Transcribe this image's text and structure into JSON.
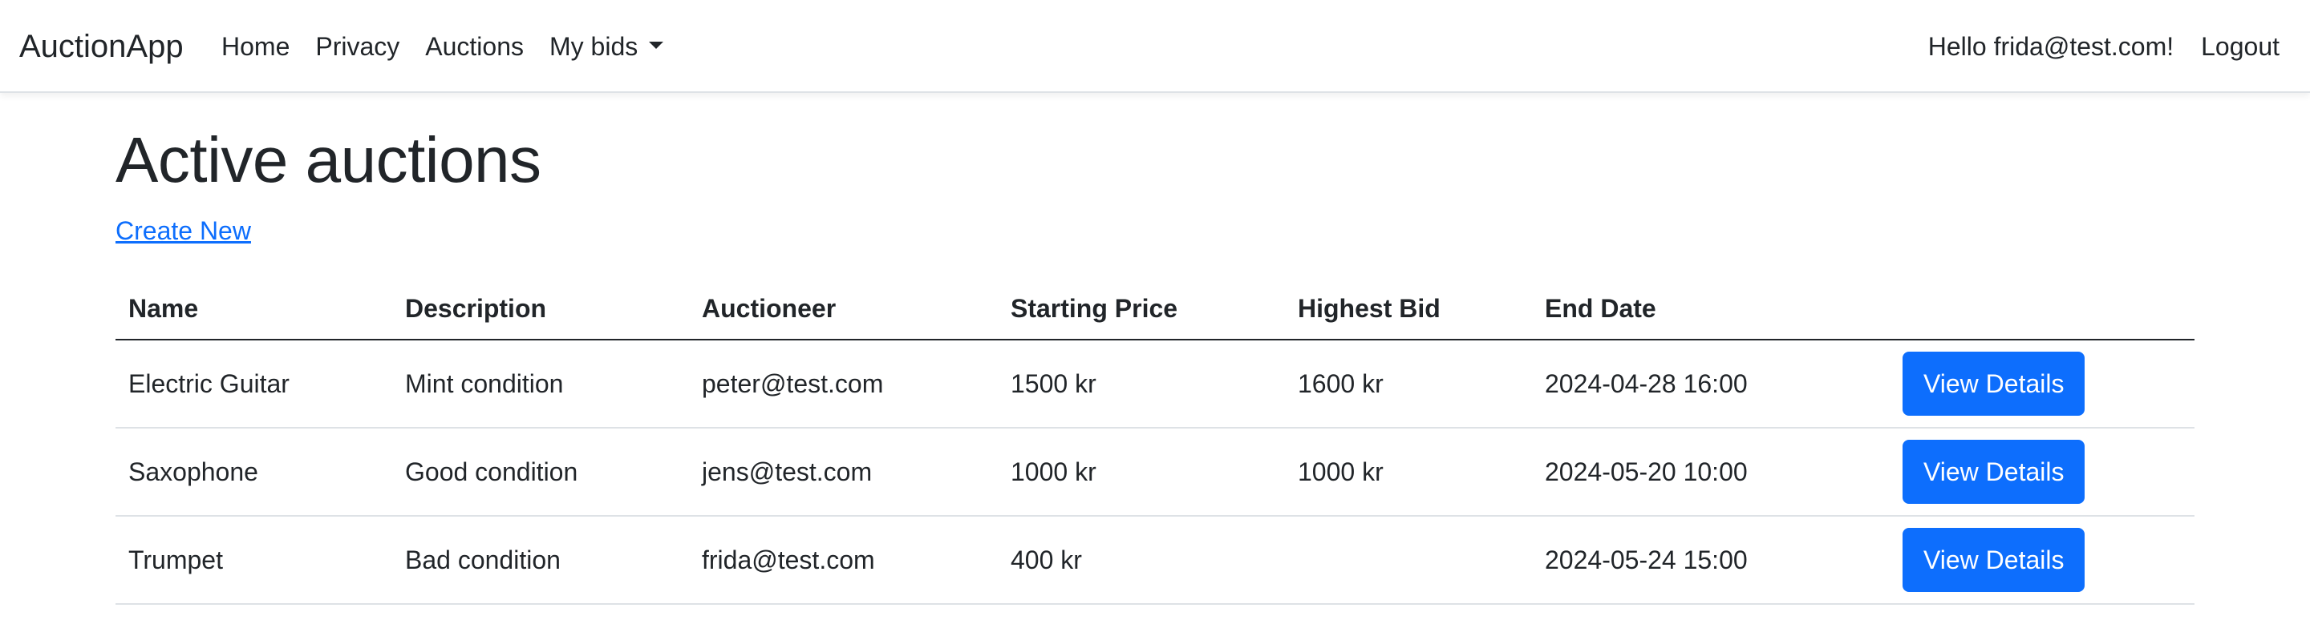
{
  "navbar": {
    "brand": "AuctionApp",
    "links": [
      "Home",
      "Privacy",
      "Auctions"
    ],
    "dropdown_label": "My bids",
    "greeting": "Hello frida@test.com!",
    "logout": "Logout"
  },
  "main": {
    "title": "Active auctions",
    "create_new": "Create New",
    "table": {
      "headers": [
        "Name",
        "Description",
        "Auctioneer",
        "Starting Price",
        "Highest Bid",
        "End Date",
        ""
      ],
      "rows": [
        {
          "name": "Electric Guitar",
          "description": "Mint condition",
          "auctioneer": "peter@test.com",
          "starting_price": "1500 kr",
          "highest_bid": "1600 kr",
          "end_date": "2024-04-28 16:00",
          "action": "View Details"
        },
        {
          "name": "Saxophone",
          "description": "Good condition",
          "auctioneer": "jens@test.com",
          "starting_price": "1000 kr",
          "highest_bid": "1000 kr",
          "end_date": "2024-05-20 10:00",
          "action": "View Details"
        },
        {
          "name": "Trumpet",
          "description": "Bad condition",
          "auctioneer": "frida@test.com",
          "starting_price": "400 kr",
          "highest_bid": "",
          "end_date": "2024-05-24 15:00",
          "action": "View Details"
        }
      ]
    }
  },
  "icons": {
    "dropdown": "caret-down-icon"
  },
  "colors": {
    "primary": "#0d6efd",
    "text": "#212529",
    "border": "#dee2e6"
  }
}
